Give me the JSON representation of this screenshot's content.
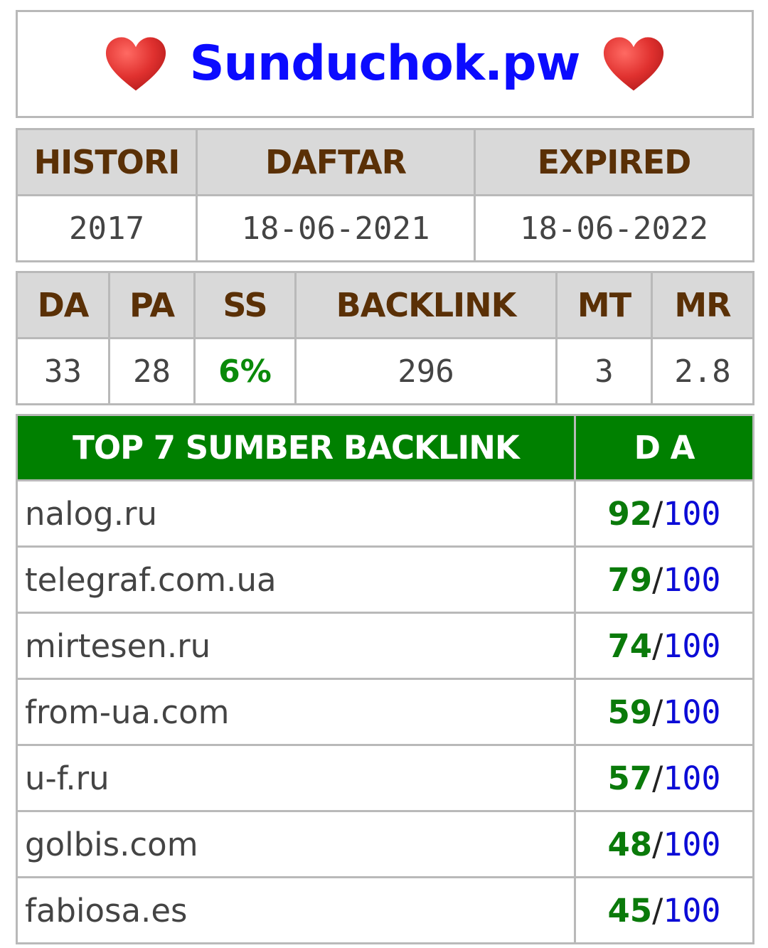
{
  "header": {
    "site_name": "Sunduchok.pw",
    "left_icon": "heart-icon",
    "right_icon": "heart-icon",
    "heart_color": "#e0312f"
  },
  "domain_info": {
    "headers": [
      "HISTORI",
      "DAFTAR",
      "EXPIRED"
    ],
    "values": [
      "2017",
      "18-06-2021",
      "18-06-2022"
    ]
  },
  "metrics": {
    "headers": [
      "DA",
      "PA",
      "SS",
      "BACKLINK",
      "MT",
      "MR"
    ],
    "values": [
      "33",
      "28",
      "6%",
      "296",
      "3",
      "2.8"
    ]
  },
  "backlinks": {
    "title": "TOP 7 SUMBER BACKLINK",
    "da_header": "D A",
    "rows": [
      {
        "source": "nalog.ru",
        "da": "92",
        "slash": "/",
        "max": "100"
      },
      {
        "source": "telegraf.com.ua",
        "da": "79",
        "slash": "/",
        "max": "100"
      },
      {
        "source": "mirtesen.ru",
        "da": "74",
        "slash": "/",
        "max": "100"
      },
      {
        "source": "from-ua.com",
        "da": "59",
        "slash": "/",
        "max": "100"
      },
      {
        "source": "u-f.ru",
        "da": "57",
        "slash": "/",
        "max": "100"
      },
      {
        "source": "golbis.com",
        "da": "48",
        "slash": "/",
        "max": "100"
      },
      {
        "source": "fabiosa.es",
        "da": "45",
        "slash": "/",
        "max": "100"
      }
    ]
  },
  "colors": {
    "header_bg": "#d9d9d9",
    "header_text": "#5a3006",
    "backlink_header_bg": "#008000",
    "da_value": "#0a7a0a",
    "da_max": "#0b0bd6",
    "title": "#0b0bff"
  }
}
